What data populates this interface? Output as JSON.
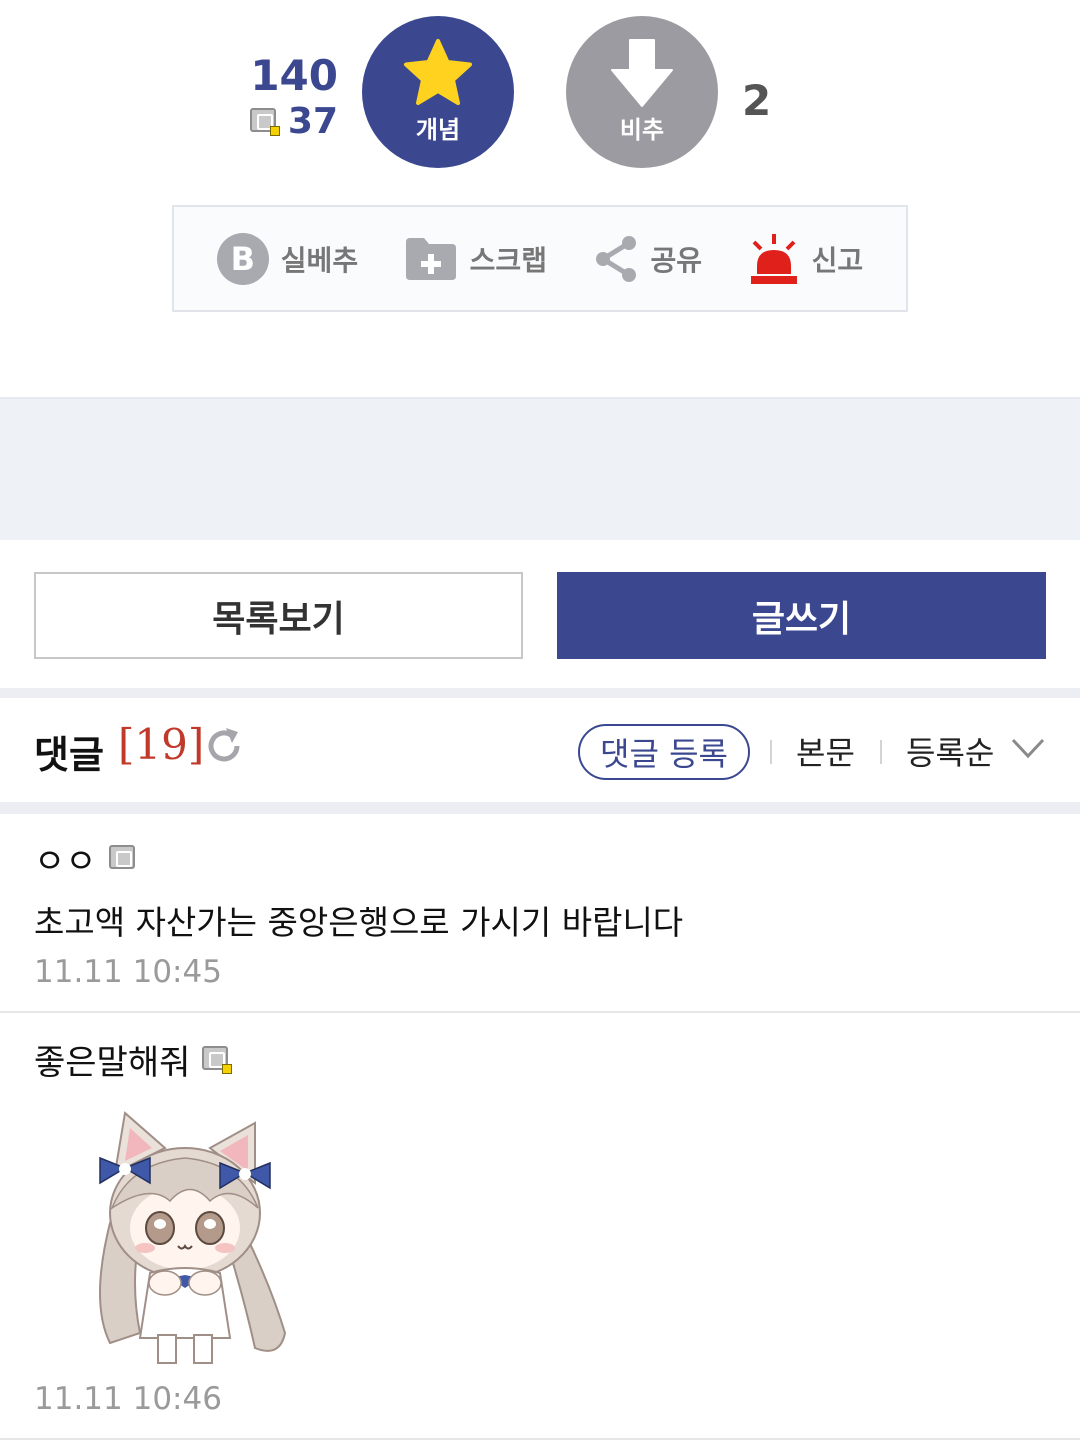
{
  "vote": {
    "up_total": "140",
    "up_fixed": "37",
    "up_label": "개념",
    "down_label": "비추",
    "down_count": "2",
    "up_color": "#3b4890",
    "down_color": "#9b9ba1"
  },
  "actions": [
    {
      "label": "실베추",
      "icon": "b-icon"
    },
    {
      "label": "스크랩",
      "icon": "folder-plus-icon"
    },
    {
      "label": "공유",
      "icon": "share-icon"
    },
    {
      "label": "신고",
      "icon": "siren-icon"
    }
  ],
  "buttons": {
    "list": "목록보기",
    "write": "글쓰기"
  },
  "comments_header": {
    "title": "댓글",
    "count": "[19]",
    "register": "댓글 등록",
    "body": "본문",
    "order": "등록순"
  },
  "comments": [
    {
      "name": "ㅇㅇ",
      "text": "초고액 자산가는 중앙은행으로 가시기 바랍니다",
      "time": "11.11 10:45"
    },
    {
      "name": "좋은말해줘",
      "time": "11.11 10:46"
    }
  ]
}
